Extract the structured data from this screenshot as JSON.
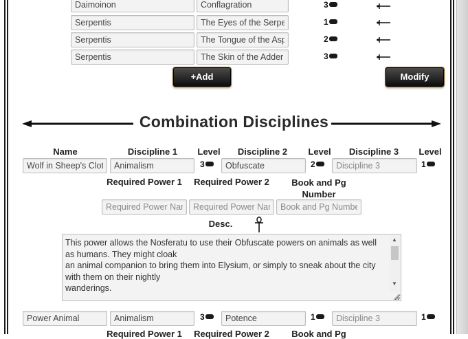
{
  "discipline_powers": {
    "rows": [
      {
        "discipline": "Daimoinon",
        "power": "Conflagration",
        "level": "3"
      },
      {
        "discipline": "Serpentis",
        "power": "The Eyes of the Serpent",
        "level": "1"
      },
      {
        "discipline": "Serpentis",
        "power": "The Tongue of the Asp",
        "level": "2"
      },
      {
        "discipline": "Serpentis",
        "power": "The Skin of the Adder",
        "level": "3"
      }
    ],
    "add_label": "+Add",
    "modify_label": "Modify"
  },
  "combination": {
    "title": "Combination Disciplines",
    "headers": {
      "name": "Name",
      "discipline1": "Discipline 1",
      "level1": "Level",
      "discipline2": "Discipline 2",
      "level2": "Level",
      "discipline3": "Discipline 3",
      "level3": "Level",
      "req_power1": "Required Power 1",
      "req_power2": "Required Power 2",
      "book": "Book and Pg Number",
      "desc": "Desc."
    },
    "placeholders": {
      "discipline3": "Discipline 3",
      "req_power": "Required Power Name",
      "book": "Book and Pg Number"
    },
    "entries": [
      {
        "name": "Wolf in Sheep's Clothing",
        "discipline1": "Animalism",
        "level1": "3",
        "discipline2": "Obfuscate",
        "level2": "2",
        "discipline3": "",
        "level3": "1",
        "req_power1": "",
        "req_power2": "",
        "book": "",
        "desc": "This power allows the Nosferatu to use their Obfuscate powers on animals as well as humans. They might cloak\nan animal companion to bring them into Elysium, or simply to sneak about the city with them on their nightly\nwanderings."
      },
      {
        "name": "Power Animal",
        "discipline1": "Animalism",
        "level1": "3",
        "discipline2": "Potence",
        "level2": "1",
        "discipline3": "",
        "level3": "1"
      }
    ],
    "partial_labels": {
      "req_power1": "Required Power 1",
      "req_power2": "Required Power 2",
      "book": "Book and Pg"
    }
  },
  "icons": {
    "level_pip": "level-pip-icon",
    "dagger": "dagger-delete-icon",
    "ankh": "ankh-icon"
  }
}
